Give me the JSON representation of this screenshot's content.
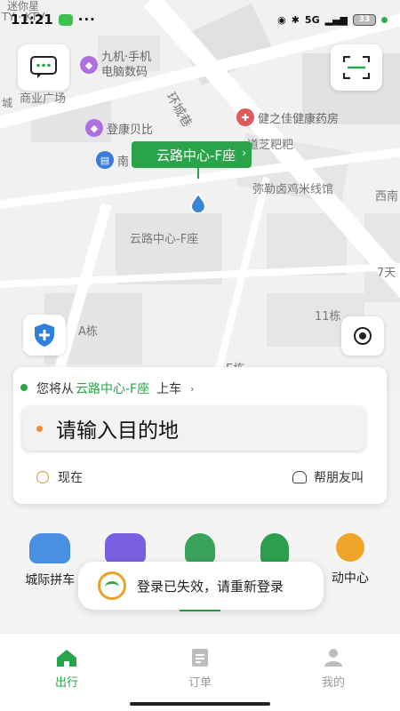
{
  "status_bar": {
    "time": "11:21",
    "network": "5G",
    "battery": "33"
  },
  "map": {
    "labels": {
      "top_left_1": "迷你星",
      "top_left_2": "TY · KTV",
      "shop_line1": "九机·手机",
      "shop_line2": "电脑数码",
      "plaza": "商业广场",
      "city": "城",
      "street": "环城巷",
      "pharmacy": "健之佳健康药房",
      "pharmacy_sub": "道芝粑粑",
      "dengkang": "登康贝比",
      "nan": "南",
      "noodle": "弥勒卤鸡米线馆",
      "xinan": "西南",
      "center_place": "云路中心-F座",
      "qitian": "7天",
      "building11": "11栋",
      "buildingA": "A栋",
      "buildingE": "E栋"
    },
    "pickup_label": "云路中心-F座"
  },
  "ride_card": {
    "from_prefix": "您将从",
    "from_place": "云路中心-F座",
    "from_suffix": "上车",
    "destination_placeholder": "请输入目的地",
    "time_label": "现在",
    "friend_label": "帮朋友叫"
  },
  "services": [
    {
      "label": "城际拼车",
      "icon": "intercity-car-icon",
      "color": "#4a90e2"
    },
    {
      "label": "",
      "icon": "taxi-icon",
      "color": "#7a5fe0"
    },
    {
      "label": "",
      "icon": "chauffeur-icon",
      "color": "#3aa25a"
    },
    {
      "label": "",
      "icon": "driver-icon",
      "color": "#2e9e4f"
    },
    {
      "label": "动中心",
      "icon": "medal-icon",
      "color": "#f0a52a"
    }
  ],
  "toast": {
    "message": "登录已失效，请重新登录"
  },
  "tabs": [
    {
      "label": "出行",
      "icon": "home-icon"
    },
    {
      "label": "订单",
      "icon": "order-icon"
    },
    {
      "label": "我的",
      "icon": "profile-icon"
    }
  ],
  "colors": {
    "accent": "#2aa44a",
    "origin_dot": "#2aa44a",
    "destination_dot": "#f28b3d"
  }
}
